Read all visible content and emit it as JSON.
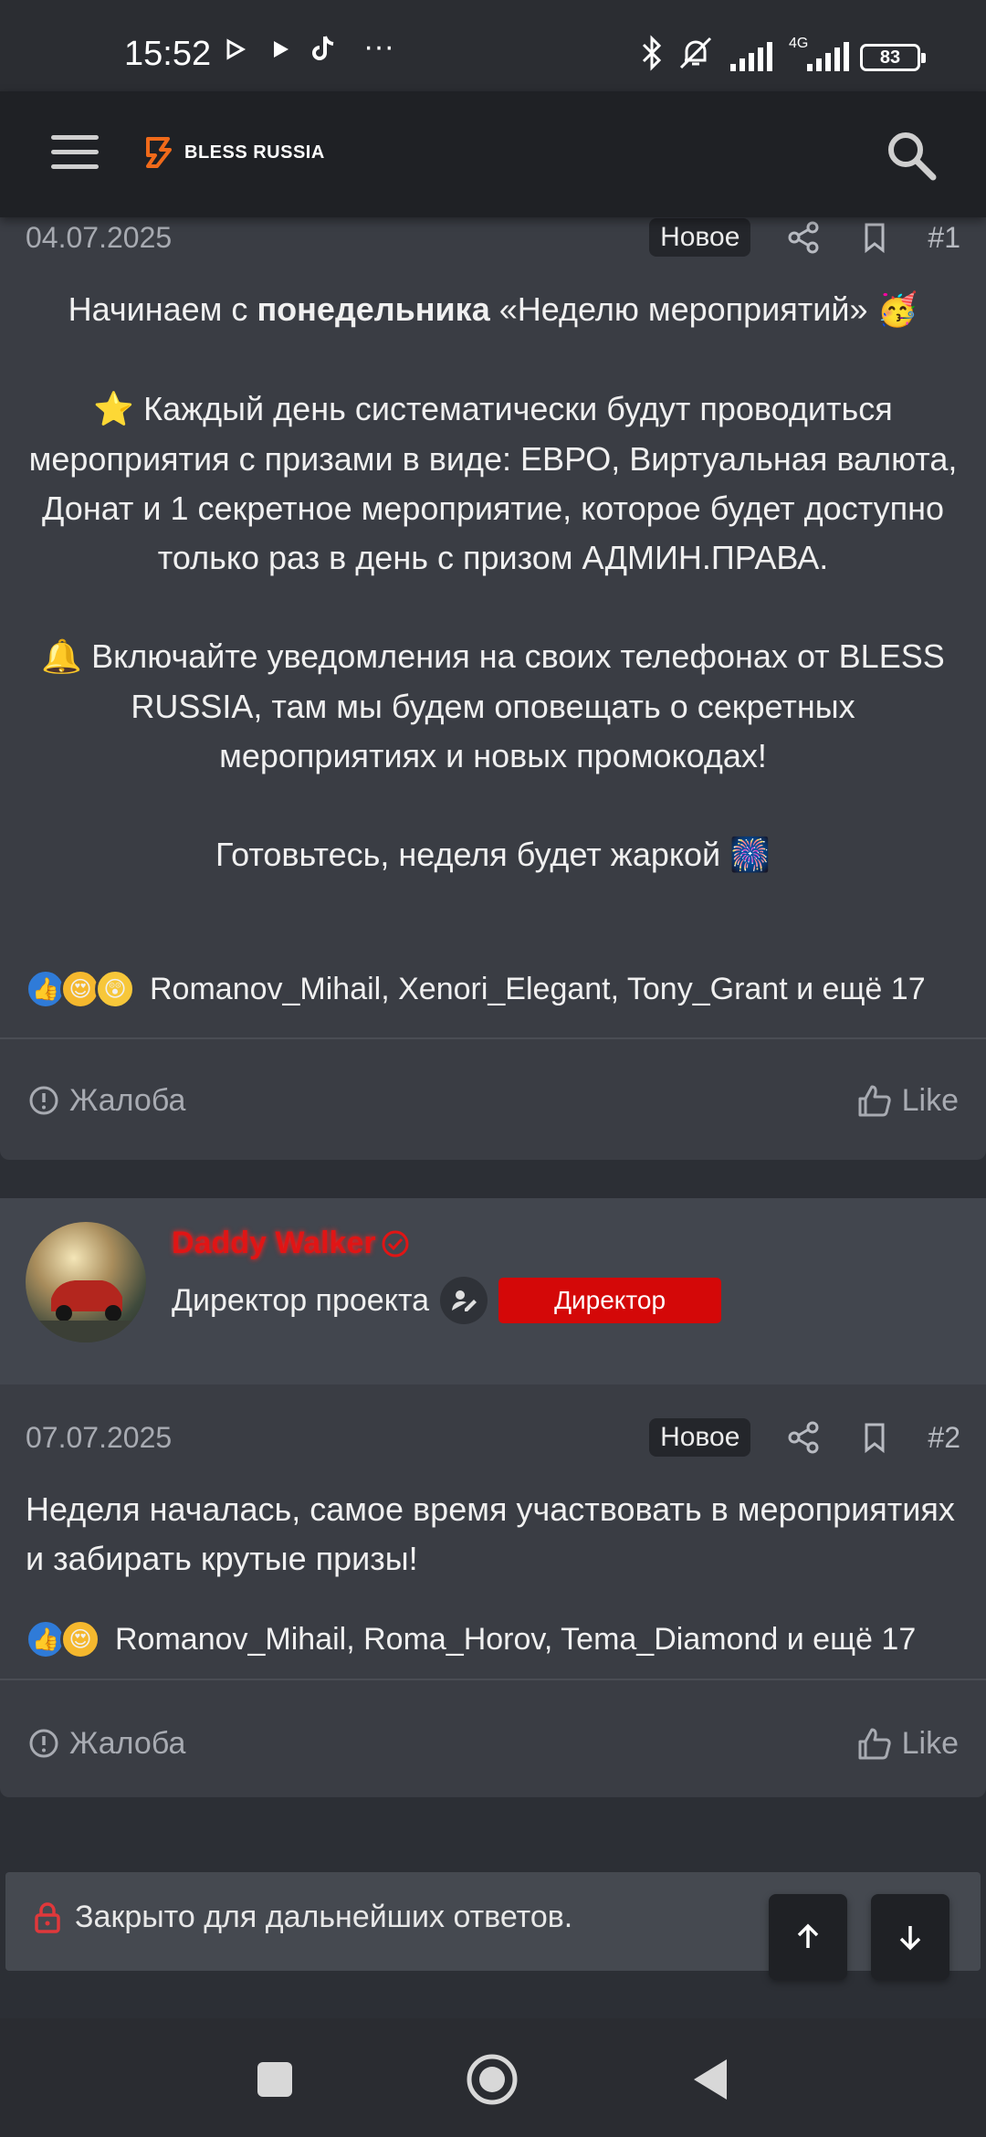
{
  "status_bar": {
    "time": "15:52",
    "network": "4G",
    "battery": "83",
    "icons": [
      "play-icon",
      "play-icon",
      "tiktok-icon",
      "more-dots-icon",
      "bluetooth-icon",
      "mute-icon",
      "signal-icon",
      "signal-icon"
    ]
  },
  "header": {
    "logo_text": "BLESS RUSSIA",
    "accent": "#f06a1a"
  },
  "post1": {
    "date": "04.07.2025",
    "badge": "Новое",
    "number": "#1",
    "lines": {
      "intro_a": "Начинаем с ",
      "intro_bold": "понедельника",
      "intro_b": " «Неделю мероприятий» ",
      "intro_emoji": "🥳",
      "p2_emoji": "⭐",
      "p2_text": " Каждый день систематически будут проводиться мероприятия с призами в виде: ЕВРО, Виртуальная валюта, Донат и 1 секретное мероприятие, которое будет доступно только раз в день с призом АДМИН.ПРАВА.",
      "p3_emoji": "🔔",
      "p3_text": " Включайте уведомления на своих телефонах от BLESS RUSSIA, там мы будем оповещать о секретных мероприятиях и новых промокодах!",
      "p4_text": "Готовьтесь, неделя будет жаркой ",
      "p4_emoji": "🎆"
    },
    "reactions_text": "Romanov_Mihail, Xenori_Elegant, Tony_Grant и ещё 17",
    "report_label": "Жалоба",
    "like_label": "Like"
  },
  "post2": {
    "author_name": "Daddy Walker",
    "author_title": "Директор проекта",
    "role_badge": "Директор",
    "date": "07.07.2025",
    "badge": "Новое",
    "number": "#2",
    "text": "Неделя началась, самое время участвовать в мероприятиях и забирать крутые призы!",
    "reactions_text": "Romanov_Mihail, Roma_Horov, Tema_Diamond и ещё 17",
    "report_label": "Жалоба",
    "like_label": "Like"
  },
  "thread_status": {
    "closed_text": "Закрыто для дальнейших ответов."
  }
}
